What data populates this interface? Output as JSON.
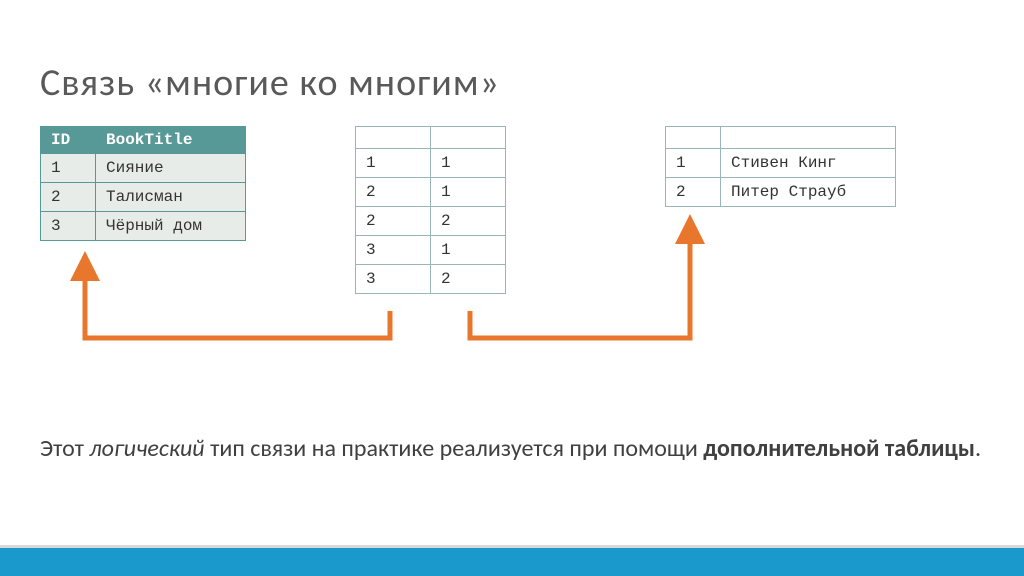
{
  "title": "Связь «многие ко многим»",
  "table1": {
    "headers": [
      "ID",
      "BookTitle"
    ],
    "rows": [
      [
        "1",
        "Сияние"
      ],
      [
        "2",
        "Талисман"
      ],
      [
        "3",
        "Чёрный дом"
      ]
    ]
  },
  "table2": {
    "rows": [
      [
        "1",
        "1"
      ],
      [
        "2",
        "1"
      ],
      [
        "2",
        "2"
      ],
      [
        "3",
        "1"
      ],
      [
        "3",
        "2"
      ]
    ]
  },
  "table3": {
    "rows": [
      [
        "1",
        "Стивен Кинг"
      ],
      [
        "2",
        "Питер Страуб"
      ]
    ]
  },
  "body_text": {
    "part1": "Этот ",
    "emphasis": "логический",
    "part2": " тип связи на практике реализуется при помощи ",
    "strong": "дополнительной таблицы",
    "part3": "."
  },
  "arrow_color": "#e8762c"
}
